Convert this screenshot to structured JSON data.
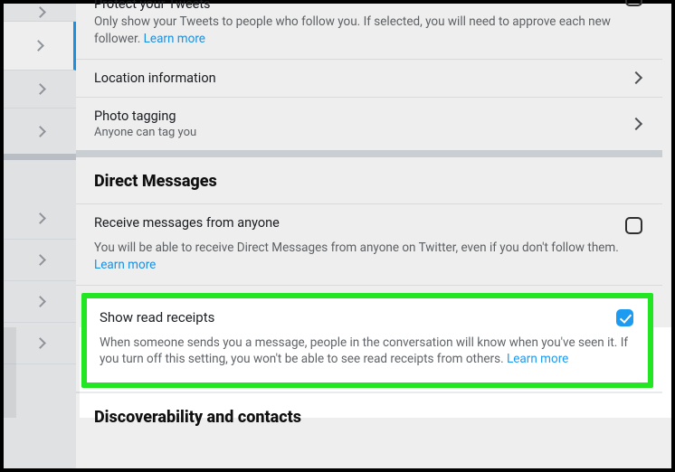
{
  "protect": {
    "title": "Protect your Tweets",
    "desc": "Only show your Tweets to people who follow you. If selected, you will need to approve each new follower. ",
    "link": "Learn more"
  },
  "location": {
    "title": "Location information"
  },
  "photo": {
    "title": "Photo tagging",
    "sub": "Anyone can tag you"
  },
  "dm_header": "Direct Messages",
  "receive": {
    "title": "Receive messages from anyone",
    "desc": "You will be able to receive Direct Messages from anyone on Twitter, even if you don't follow them. ",
    "link": "Learn more"
  },
  "readreceipts": {
    "title": "Show read receipts",
    "desc": "When someone sends you a message, people in the conversation will know when you've seen it. If you turn off this setting, you won't be able to see read receipts from others. ",
    "link": "Learn more"
  },
  "disc_header": "Discoverability and contacts"
}
